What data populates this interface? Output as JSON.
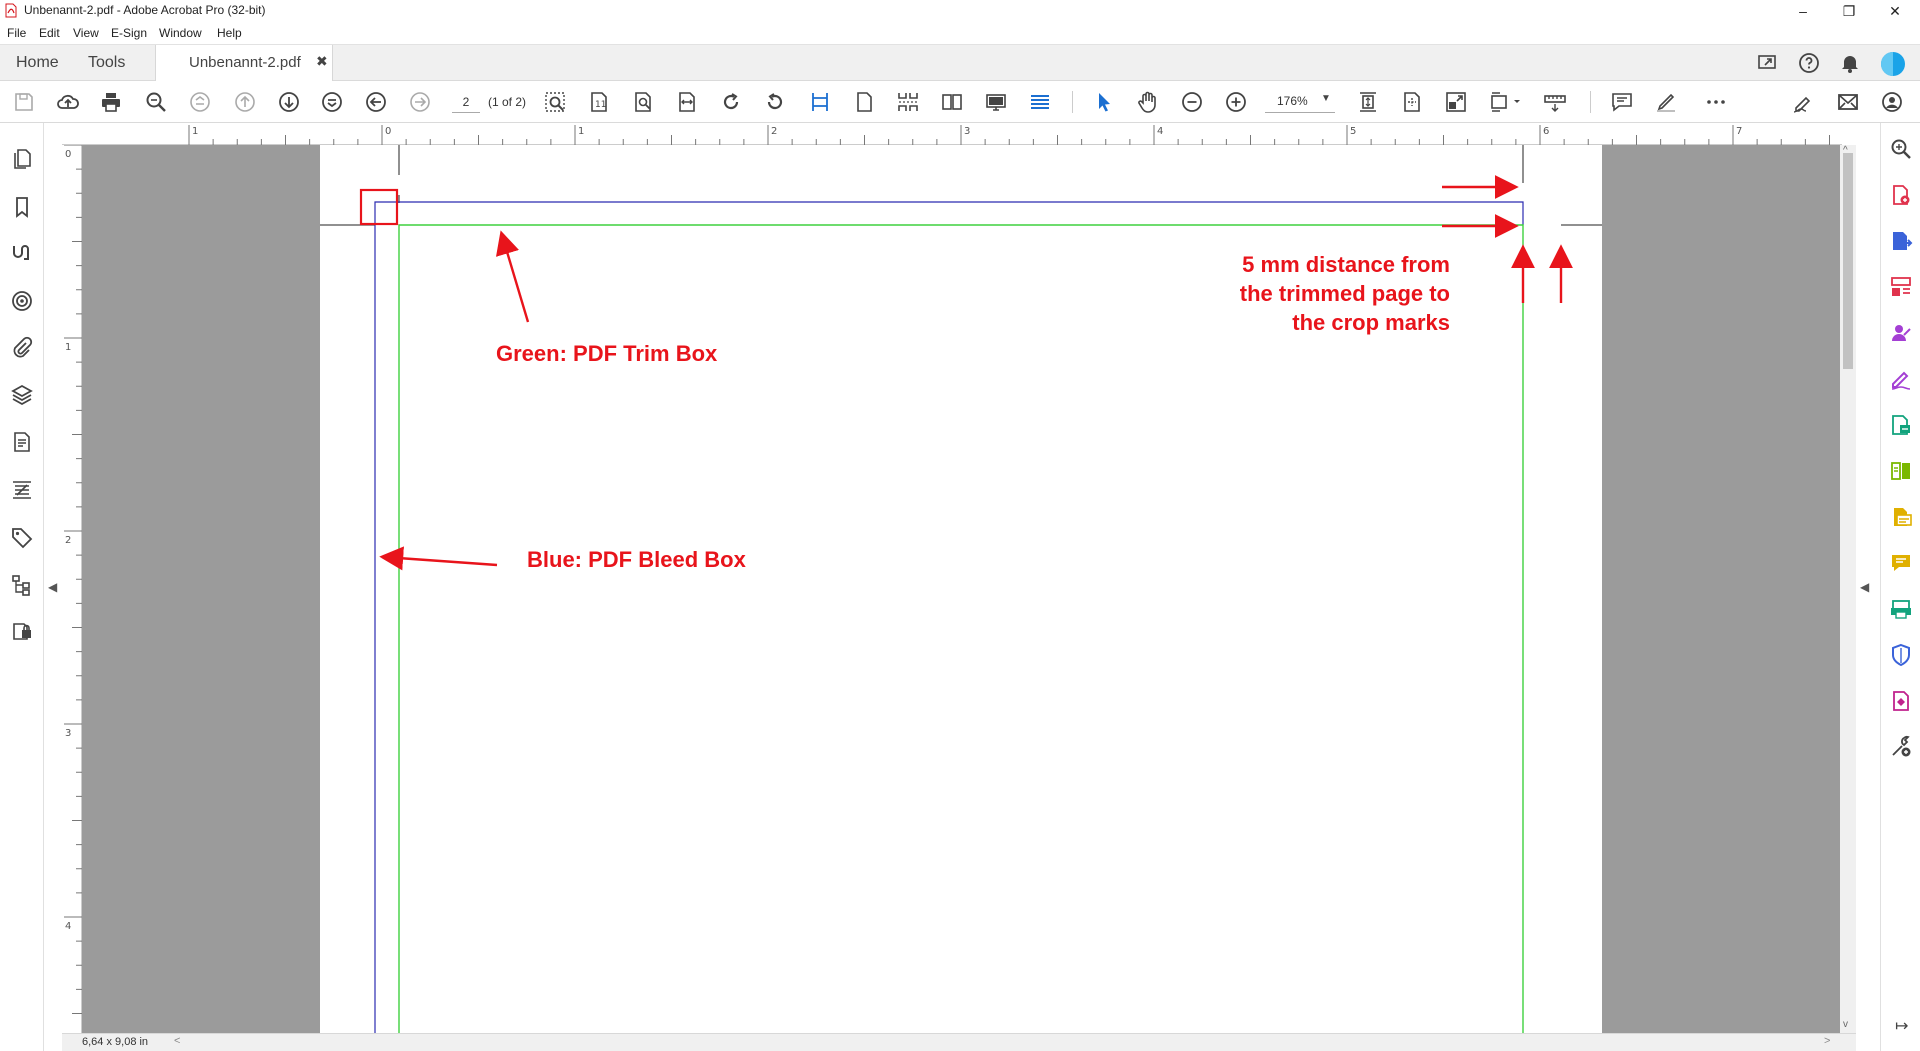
{
  "window": {
    "title": "Unbenannt-2.pdf - Adobe Acrobat Pro (32-bit)",
    "controls": [
      "–",
      "❐",
      "✕"
    ]
  },
  "menu": [
    "File",
    "Edit",
    "View",
    "E-Sign",
    "Window",
    "Help"
  ],
  "tabs": {
    "home": "Home",
    "tools": "Tools",
    "document": "Unbenannt-2.pdf",
    "close": "✖"
  },
  "toolbar": {
    "page_number": "2",
    "page_of": "(1 of 2)",
    "zoom": "176%",
    "zoom_arrow": "▼"
  },
  "rulers": {
    "top": [
      "1",
      "0",
      "1",
      "2",
      "3",
      "4",
      "5",
      "6",
      "7"
    ],
    "left": [
      "0",
      "1",
      "2",
      "3",
      "4"
    ]
  },
  "status": {
    "page_size": "6,64 x 9,08 in",
    "scroll_left": "<",
    "scroll_right": ">",
    "scroll_up": "^",
    "scroll_down": "v",
    "collapse_left": "◀",
    "collapse_right": "◀",
    "exit_icon_glyph": "↦"
  },
  "annotations": {
    "trim_box": "Green: PDF Trim Box",
    "bleed_box": "Blue: PDF Bleed Box",
    "distance_line1": "5 mm distance from",
    "distance_line2": "the trimmed page to",
    "distance_line3": "the crop marks"
  },
  "colors": {
    "trim_box": "#3fd13f",
    "bleed_box": "#2b2bb0",
    "annotation": "#e8141b",
    "pasteboard": "#9b9b9b"
  },
  "icons": {
    "left_nav": [
      "pages-icon",
      "bookmark-icon",
      "signature-icon",
      "layers-target-icon",
      "attachment-icon",
      "layers-icon",
      "content-icon",
      "order-icon",
      "tags-icon",
      "model-tree-icon",
      "security-icon"
    ],
    "right_tools": [
      "search-icon",
      "create-pdf-icon",
      "export-pdf-icon",
      "organize-pages-icon",
      "request-signature-icon",
      "fill-sign-icon",
      "send-for-review-icon",
      "edit-pdf-icon",
      "compare-icon",
      "comment-icon",
      "print-production-icon",
      "protect-icon",
      "rich-media-icon",
      "more-tools-icon"
    ]
  }
}
